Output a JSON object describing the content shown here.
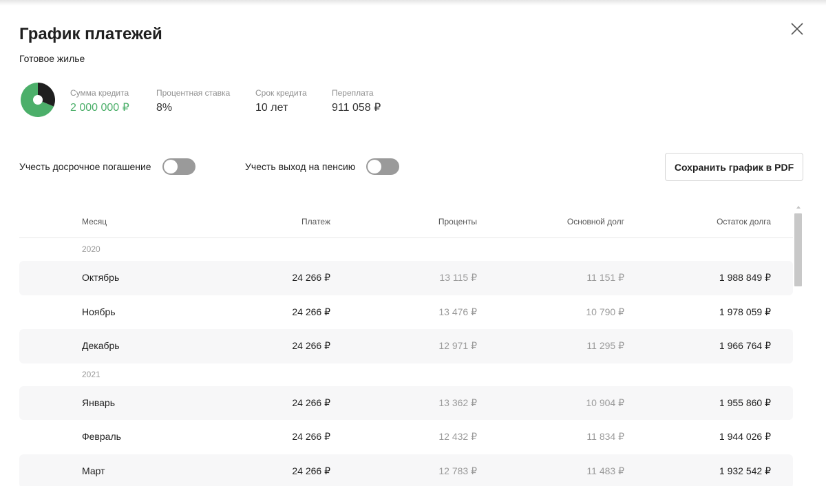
{
  "header": {
    "title": "График платежей",
    "subtitle": "Готовое жилье",
    "close_icon": "close-icon"
  },
  "summary": {
    "pie": {
      "principal_share": 0.687,
      "interest_share": 0.313,
      "principal_color": "#4caf6a",
      "interest_color": "#1f1f1f"
    },
    "loan_amount_label": "Сумма кредита",
    "loan_amount_value": "2 000 000 ₽",
    "rate_label": "Процентная ставка",
    "rate_value": "8%",
    "term_label": "Срок кредита",
    "term_value": "10 лет",
    "overpayment_label": "Переплата",
    "overpayment_value": "911 058 ₽"
  },
  "options": {
    "early_repayment_label": "Учесть досрочное погашение",
    "early_repayment_on": false,
    "retirement_label": "Учесть выход на пенсию",
    "retirement_on": false,
    "save_pdf_label": "Сохранить график в PDF"
  },
  "table": {
    "columns": [
      "Месяц",
      "Платеж",
      "Проценты",
      "Основной долг",
      "Остаток долга"
    ],
    "groups": [
      {
        "year": "2020",
        "rows": [
          {
            "month": "Октябрь",
            "payment": "24 266 ₽",
            "interest": "13 115 ₽",
            "principal": "11 151 ₽",
            "balance": "1 988 849 ₽"
          },
          {
            "month": "Ноябрь",
            "payment": "24 266 ₽",
            "interest": "13 476 ₽",
            "principal": "10 790 ₽",
            "balance": "1 978 059 ₽"
          },
          {
            "month": "Декабрь",
            "payment": "24 266 ₽",
            "interest": "12 971 ₽",
            "principal": "11 295 ₽",
            "balance": "1 966 764 ₽"
          }
        ]
      },
      {
        "year": "2021",
        "rows": [
          {
            "month": "Январь",
            "payment": "24 266 ₽",
            "interest": "13 362 ₽",
            "principal": "10 904 ₽",
            "balance": "1 955 860 ₽"
          },
          {
            "month": "Февраль",
            "payment": "24 266 ₽",
            "interest": "12 432 ₽",
            "principal": "11 834 ₽",
            "balance": "1 944 026 ₽"
          },
          {
            "month": "Март",
            "payment": "24 266 ₽",
            "interest": "12 783 ₽",
            "principal": "11 483 ₽",
            "balance": "1 932 542 ₽"
          }
        ]
      }
    ]
  },
  "colors": {
    "accent_green": "#4caf6a",
    "muted_text": "#9a9a9a",
    "row_shade": "#f7f7f8"
  }
}
